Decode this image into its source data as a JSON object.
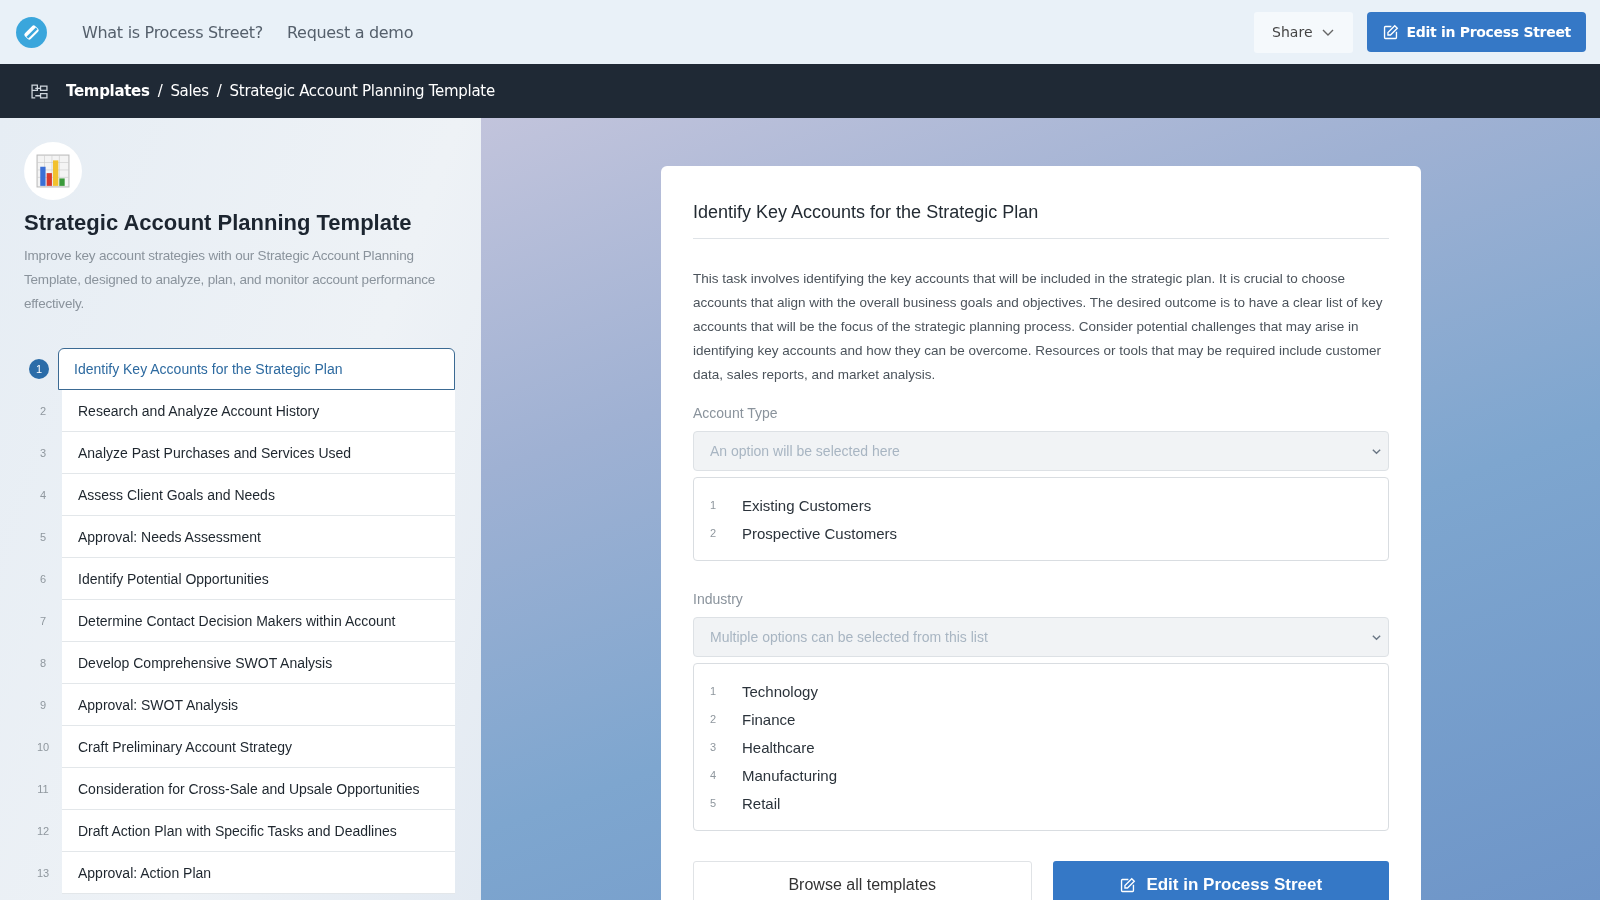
{
  "header": {
    "nav_links": [
      "What is Process Street?",
      "Request a demo"
    ],
    "share_button": "Share",
    "edit_button": "Edit in Process Street"
  },
  "breadcrumb": {
    "items": [
      "Templates",
      "Sales",
      "Strategic Account Planning Template"
    ],
    "separator": "/"
  },
  "sidebar": {
    "title": "Strategic Account Planning Template",
    "description": "Improve key account strategies with our Strategic Account Planning Template, designed to analyze, plan, and monitor account performance effectively.",
    "steps": [
      {
        "number": "1",
        "label": "Identify Key Accounts for the Strategic Plan",
        "selected": true
      },
      {
        "number": "2",
        "label": "Research and Analyze Account History",
        "selected": false
      },
      {
        "number": "3",
        "label": "Analyze Past Purchases and Services Used",
        "selected": false
      },
      {
        "number": "4",
        "label": "Assess Client Goals and Needs",
        "selected": false
      },
      {
        "number": "5",
        "label": "Approval: Needs Assessment",
        "selected": false
      },
      {
        "number": "6",
        "label": "Identify Potential Opportunities",
        "selected": false
      },
      {
        "number": "7",
        "label": "Determine Contact Decision Makers within Account",
        "selected": false
      },
      {
        "number": "8",
        "label": "Develop Comprehensive SWOT Analysis",
        "selected": false
      },
      {
        "number": "9",
        "label": "Approval: SWOT Analysis",
        "selected": false
      },
      {
        "number": "10",
        "label": "Craft Preliminary Account Strategy",
        "selected": false
      },
      {
        "number": "11",
        "label": "Consideration for Cross-Sale and Upsale Opportunities",
        "selected": false
      },
      {
        "number": "12",
        "label": "Draft Action Plan with Specific Tasks and Deadlines",
        "selected": false
      },
      {
        "number": "13",
        "label": "Approval: Action Plan",
        "selected": false
      }
    ]
  },
  "task": {
    "title": "Identify Key Accounts for the Strategic Plan",
    "description": "This task involves identifying the key accounts that will be included in the strategic plan. It is crucial to choose accounts that align with the overall business goals and objectives. The desired outcome is to have a clear list of key accounts that will be the focus of the strategic planning process. Consider potential challenges that may arise in identifying key accounts and how they can be overcome. Resources or tools that may be required include customer data, sales reports, and market analysis.",
    "fields": [
      {
        "label": "Account Type",
        "placeholder": "An option will be selected here",
        "options": [
          {
            "number": "1",
            "label": "Existing Customers"
          },
          {
            "number": "2",
            "label": "Prospective Customers"
          }
        ]
      },
      {
        "label": "Industry",
        "placeholder": "Multiple options can be selected from this list",
        "options": [
          {
            "number": "1",
            "label": "Technology"
          },
          {
            "number": "2",
            "label": "Finance"
          },
          {
            "number": "3",
            "label": "Healthcare"
          },
          {
            "number": "4",
            "label": "Manufacturing"
          },
          {
            "number": "5",
            "label": "Retail"
          }
        ]
      }
    ],
    "browse_button": "Browse all templates",
    "edit_button": "Edit in Process Street"
  }
}
